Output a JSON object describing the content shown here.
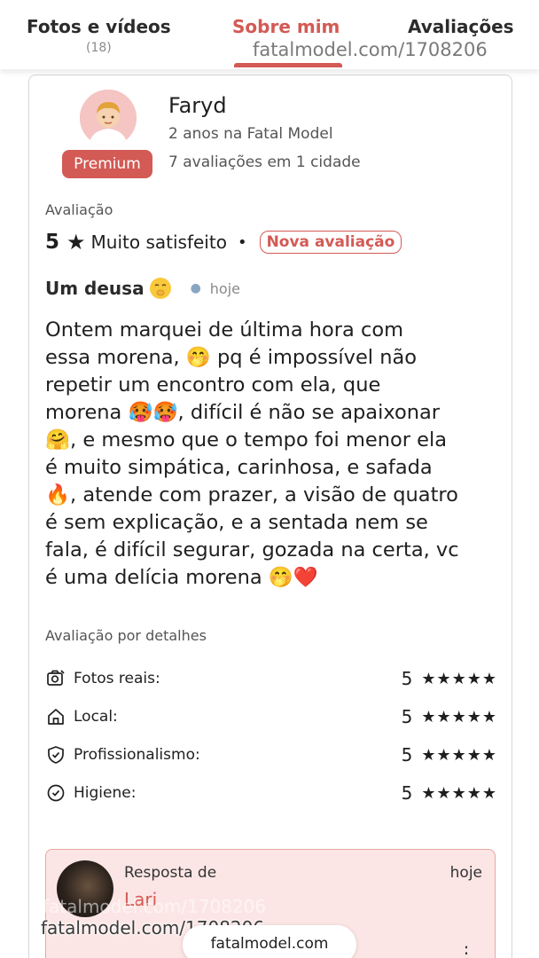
{
  "tabs": [
    {
      "label": "Fotos e vídeos",
      "count": "(18)"
    },
    {
      "label": "Sobre mim",
      "count": ""
    },
    {
      "label": "Avaliações",
      "count": ""
    }
  ],
  "active_tab": "Sobre mim",
  "watermark": {
    "top": "fatalmodel.com/1708206",
    "bottom_faint": "fatalmodel.com/1708206",
    "bottom": "fatalmodel.com/1708206",
    "pill": "fatalmodel.com"
  },
  "reviewer": {
    "name": "Faryd",
    "badge": "Premium",
    "tenure": "2 anos na Fatal Model",
    "summary": "7 avaliações em 1 cidade"
  },
  "rating": {
    "label": "Avaliação",
    "score": "5",
    "text": "Muito satisfeito",
    "badge": "Nova avaliação"
  },
  "review": {
    "title": "Um deusa",
    "date": "hoje",
    "body_lines": [
      "Ontem marquei de última hora com",
      "essa morena, 🤭 pq é impossível não",
      "repetir um encontro com ela, que",
      "morena 🥵🥵, difícil é não se apaixonar",
      "🤗, e mesmo que o tempo foi menor ela",
      "é muito simpática, carinhosa, e safada",
      "🔥, atende com prazer, a visão de quatro",
      "é sem explicação, e a sentada nem se",
      "fala, é difícil segurar, gozada na certa, vc",
      "é uma delícia morena 🤭❤️"
    ]
  },
  "details": {
    "label": "Avaliação por detalhes",
    "items": [
      {
        "label": "Fotos reais:",
        "score": "5",
        "stars": "★★★★★",
        "icon": "camera-icon"
      },
      {
        "label": "Local:",
        "score": "5",
        "stars": "★★★★★",
        "icon": "home-icon"
      },
      {
        "label": "Profissionalismo:",
        "score": "5",
        "stars": "★★★★★",
        "icon": "shield-check-icon"
      },
      {
        "label": "Higiene:",
        "score": "5",
        "stars": "★★★★★",
        "icon": "check-circle-icon"
      }
    ]
  },
  "reply": {
    "from_label": "Resposta de",
    "name": "Lari",
    "date": "hoje",
    "more": "⋮"
  },
  "colors": {
    "accent": "#d35a55",
    "reply_bg": "#fbe6e5"
  }
}
